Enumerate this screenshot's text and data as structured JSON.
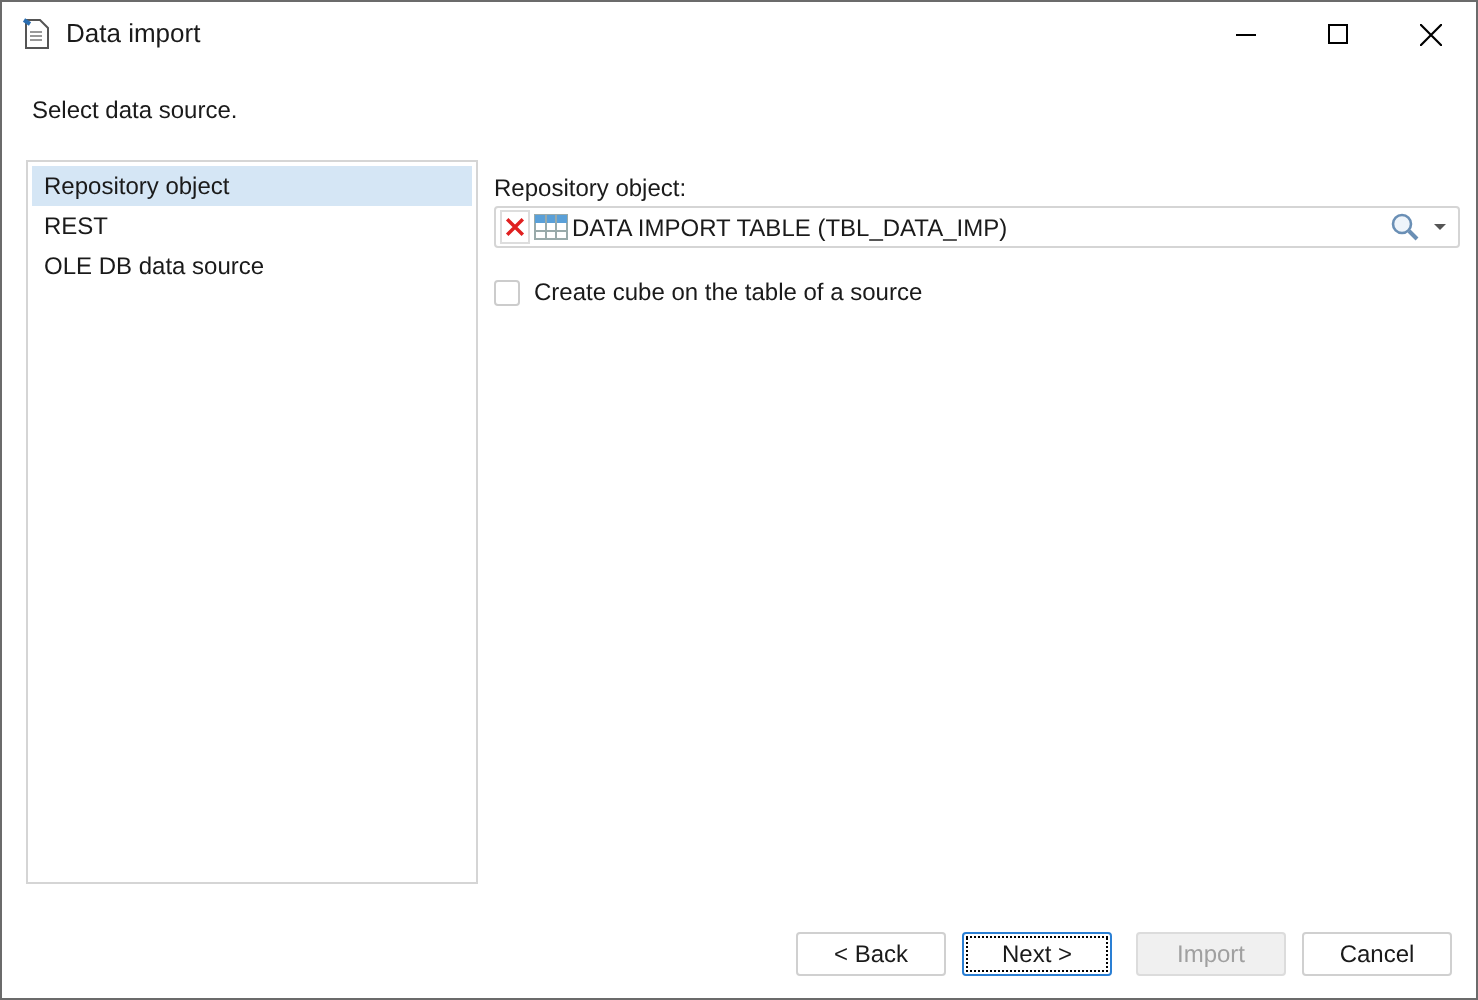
{
  "window": {
    "title": "Data import"
  },
  "instruction": "Select data source.",
  "sources": [
    {
      "label": "Repository object",
      "selected": true
    },
    {
      "label": "REST",
      "selected": false
    },
    {
      "label": "OLE DB data source",
      "selected": false
    }
  ],
  "repository_field": {
    "label": "Repository object:",
    "value": "DATA IMPORT TABLE (TBL_DATA_IMP)"
  },
  "create_cube": {
    "label": "Create cube on the table of a source",
    "checked": false
  },
  "buttons": [
    {
      "label": "< Back",
      "disabled": false,
      "focused": false
    },
    {
      "label": "Next >",
      "disabled": false,
      "focused": true
    },
    {
      "label": "Import",
      "disabled": true,
      "focused": false
    },
    {
      "label": "Cancel",
      "disabled": false,
      "focused": false
    }
  ]
}
